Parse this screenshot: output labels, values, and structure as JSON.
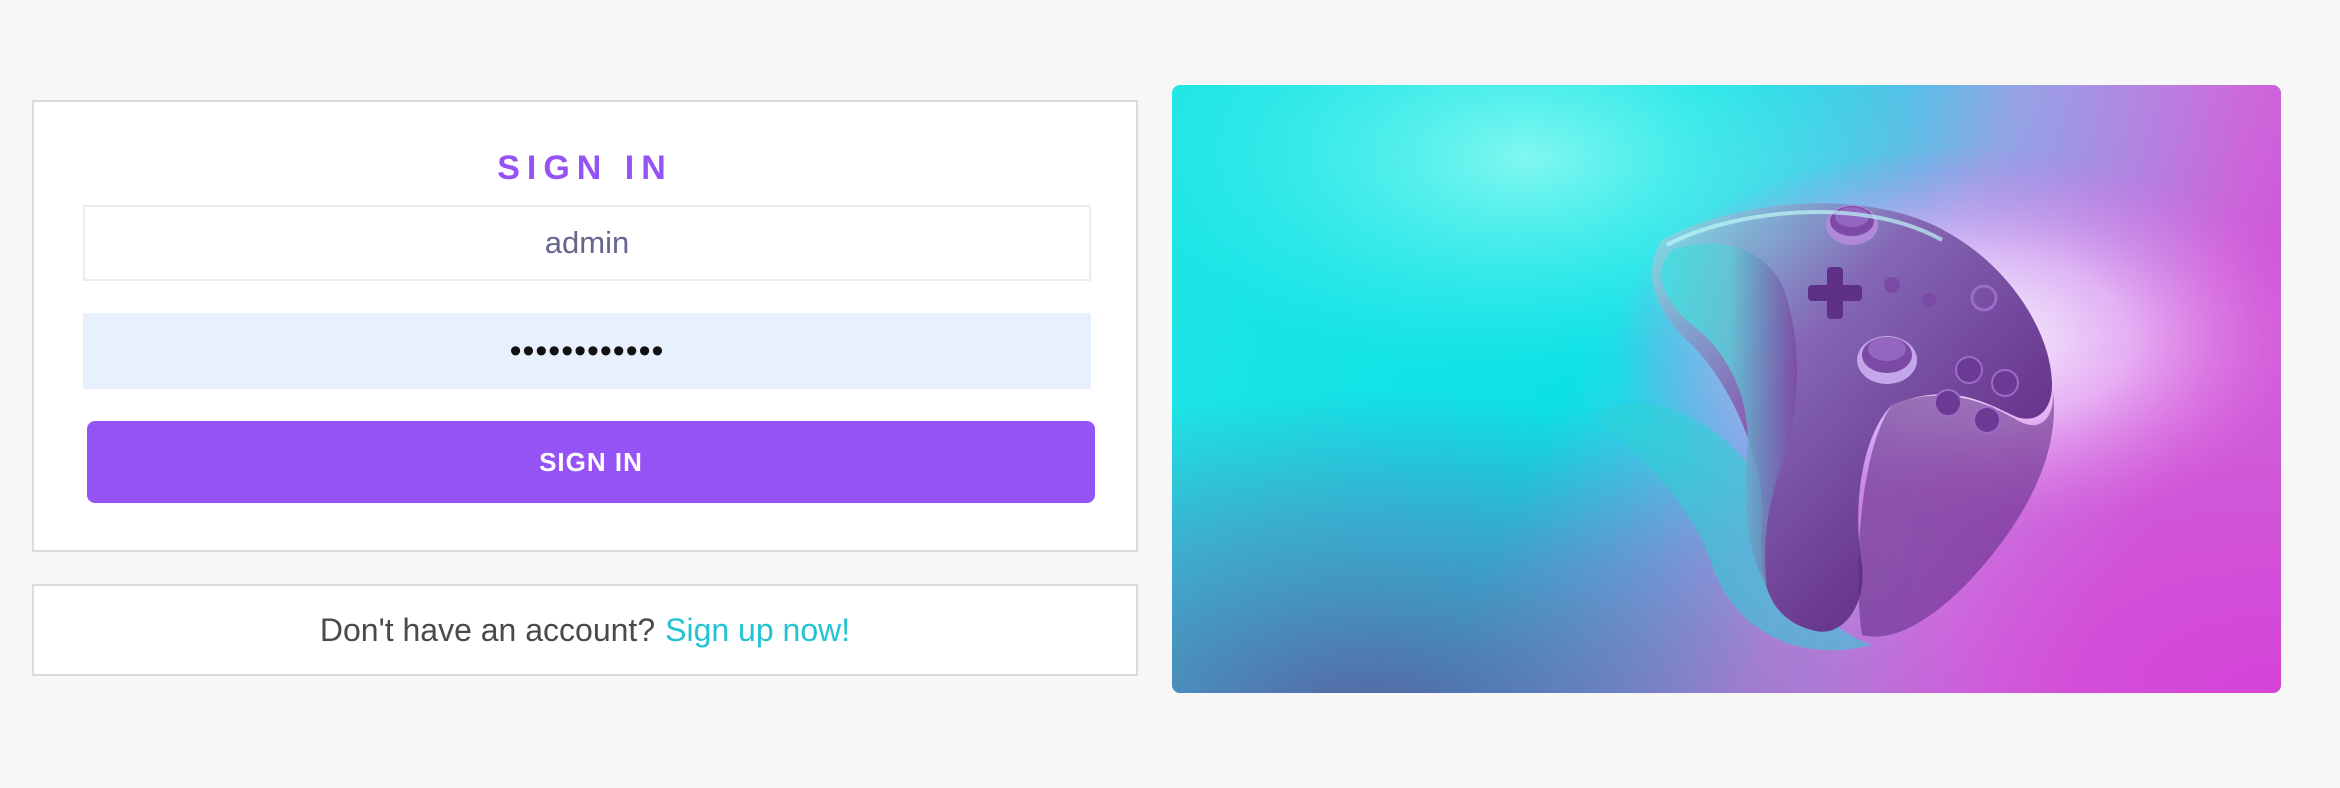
{
  "login": {
    "title": "SIGN IN",
    "username_value": "admin",
    "password_value": "............",
    "submit_label": "SIGN IN"
  },
  "signup": {
    "prompt": "Don't have an account?",
    "link_label": "Sign up now!"
  },
  "colors": {
    "accent": "#9553f5",
    "link": "#22c3d2",
    "background": "#f7f7f7"
  },
  "hero_image": {
    "subject": "game-controller"
  }
}
